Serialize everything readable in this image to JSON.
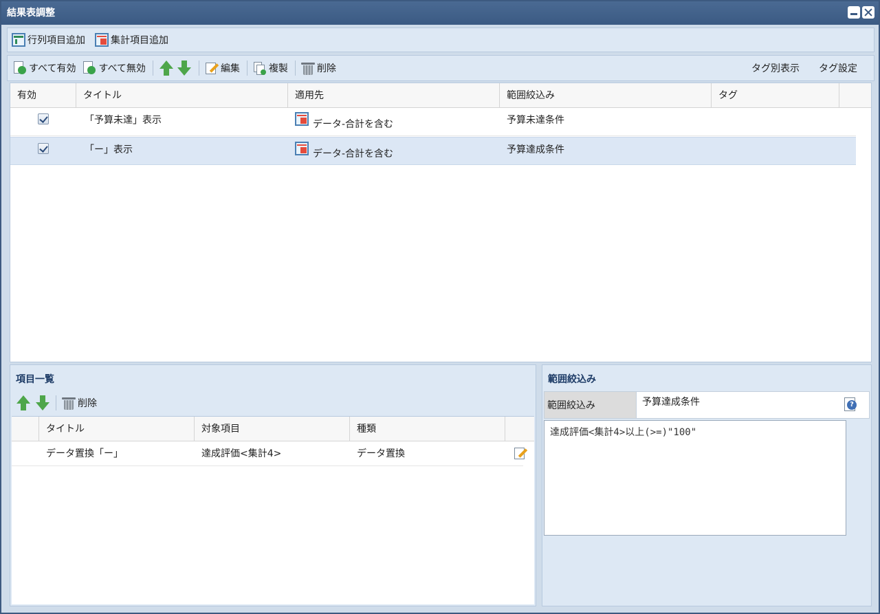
{
  "window": {
    "title": "結果表調整"
  },
  "toolbar1": {
    "add_row_col": "行列項目追加",
    "add_summary": "集計項目追加"
  },
  "toolbar2": {
    "enable_all": "すべて有効",
    "disable_all": "すべて無効",
    "edit": "編集",
    "duplicate": "複製",
    "delete": "削除",
    "tag_view": "タグ別表示",
    "tag_settings": "タグ設定"
  },
  "main_grid": {
    "columns": [
      "有効",
      "タイトル",
      "適用先",
      "範囲絞込み",
      "タグ"
    ],
    "rows": [
      {
        "enabled": true,
        "title": "「予算未達」表示",
        "target": "データ-合計を含む",
        "filter": "予算未達条件",
        "tag": ""
      },
      {
        "enabled": true,
        "title": "「ー」表示",
        "target": "データ-合計を含む",
        "filter": "予算達成条件",
        "tag": "",
        "selected": true
      }
    ]
  },
  "items_pane": {
    "title": "項目一覧",
    "delete": "削除",
    "columns": [
      "タイトル",
      "対象項目",
      "種類"
    ],
    "rows": [
      {
        "title": "データ置換「ー」",
        "target": "達成評価<集計4>",
        "type": "データ置換"
      }
    ]
  },
  "filter_pane": {
    "title": "範囲絞込み",
    "field_label": "範囲絞込み",
    "field_value": "予算達成条件",
    "condition": "達成評価<集計4>以上(>=)\"100\""
  }
}
